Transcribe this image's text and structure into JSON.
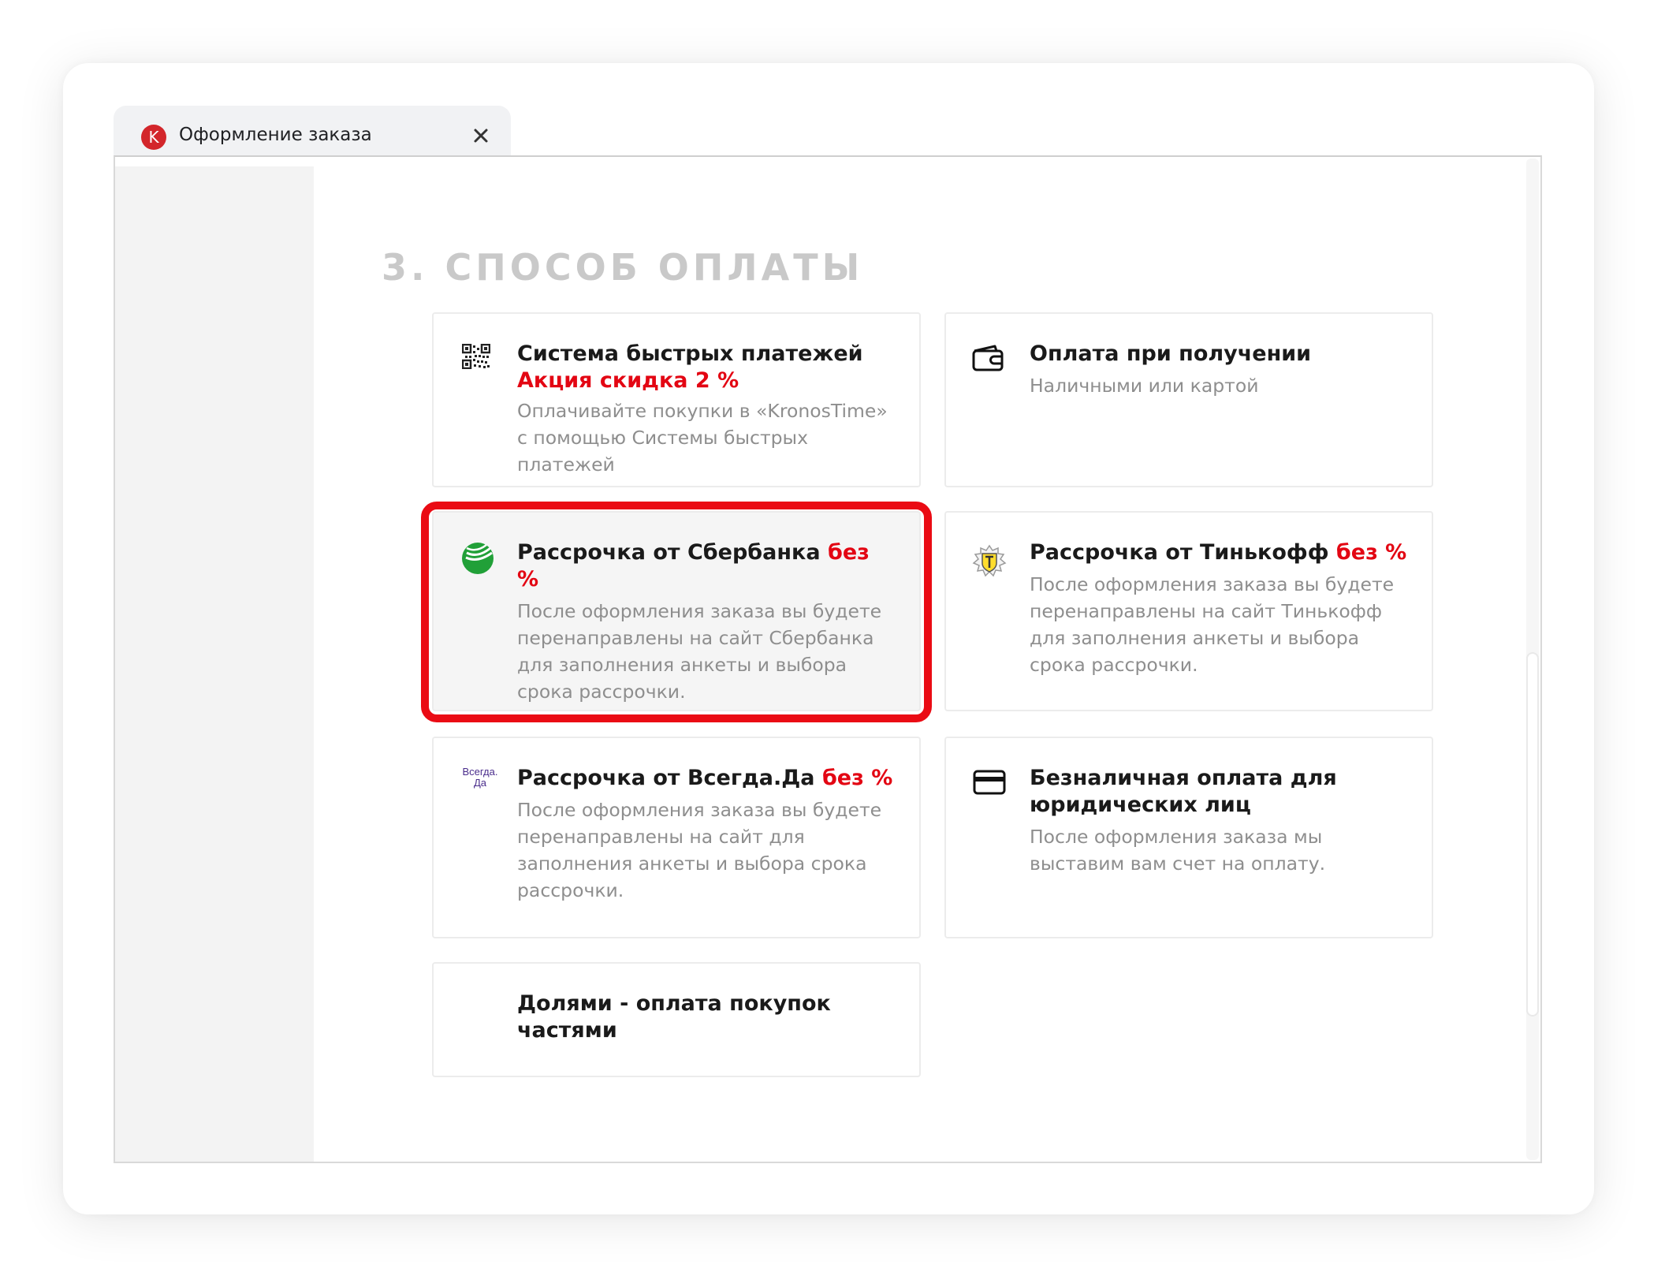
{
  "tab": {
    "favicon_letter": "K",
    "title": "Оформление заказа",
    "close_glyph": "✕"
  },
  "section": {
    "title": "3. СПОСОБ ОПЛАТЫ"
  },
  "payment_options": [
    {
      "icon": "qr-code-icon",
      "title": "Система быстрых платежей",
      "promo": "Акция скидка 2 %",
      "description": "Оплачивайте покупки в «KronosTime» с помощью Системы быстрых платежей"
    },
    {
      "icon": "wallet-icon",
      "title": "Оплата при получении",
      "description": "Наличными или картой"
    },
    {
      "icon": "sberbank-logo-icon",
      "title": "Рассрочка от Сбербанка",
      "title_suffix": "без %",
      "description": "После оформления заказа вы будете перенаправлены на сайт Сбербанка для заполнения анкеты и выбора срока рассрочки.",
      "selected": true
    },
    {
      "icon": "tinkoff-logo-icon",
      "title": "Рассрочка от Тинькофф",
      "title_suffix": "без %",
      "description": "После оформления заказа вы будете перенаправлены на сайт Тинькофф для заполнения анкеты и выбора срока рассрочки."
    },
    {
      "icon": "vsegda-da-logo-icon",
      "logo_text_line1": "Всегда.",
      "logo_text_line2": "Да",
      "title": "Рассрочка от Всегда.Да",
      "title_suffix": "без %",
      "description": "После оформления заказа вы будете перенаправлены на сайт для заполнения анкеты и выбора срока рассрочки."
    },
    {
      "icon": "credit-card-icon",
      "title": "Безналичная оплата для юридических лиц",
      "description": "После оформления заказа мы выставим вам счет на оплату."
    },
    {
      "icon": "",
      "title": "Долями - оплата покупок частями"
    }
  ],
  "colors": {
    "accent_red": "#e30613",
    "highlight_red": "#ea0b14",
    "section_title_gray": "#c9c9c9",
    "description_gray": "#8e8e8e",
    "sber_green": "#21a038"
  }
}
